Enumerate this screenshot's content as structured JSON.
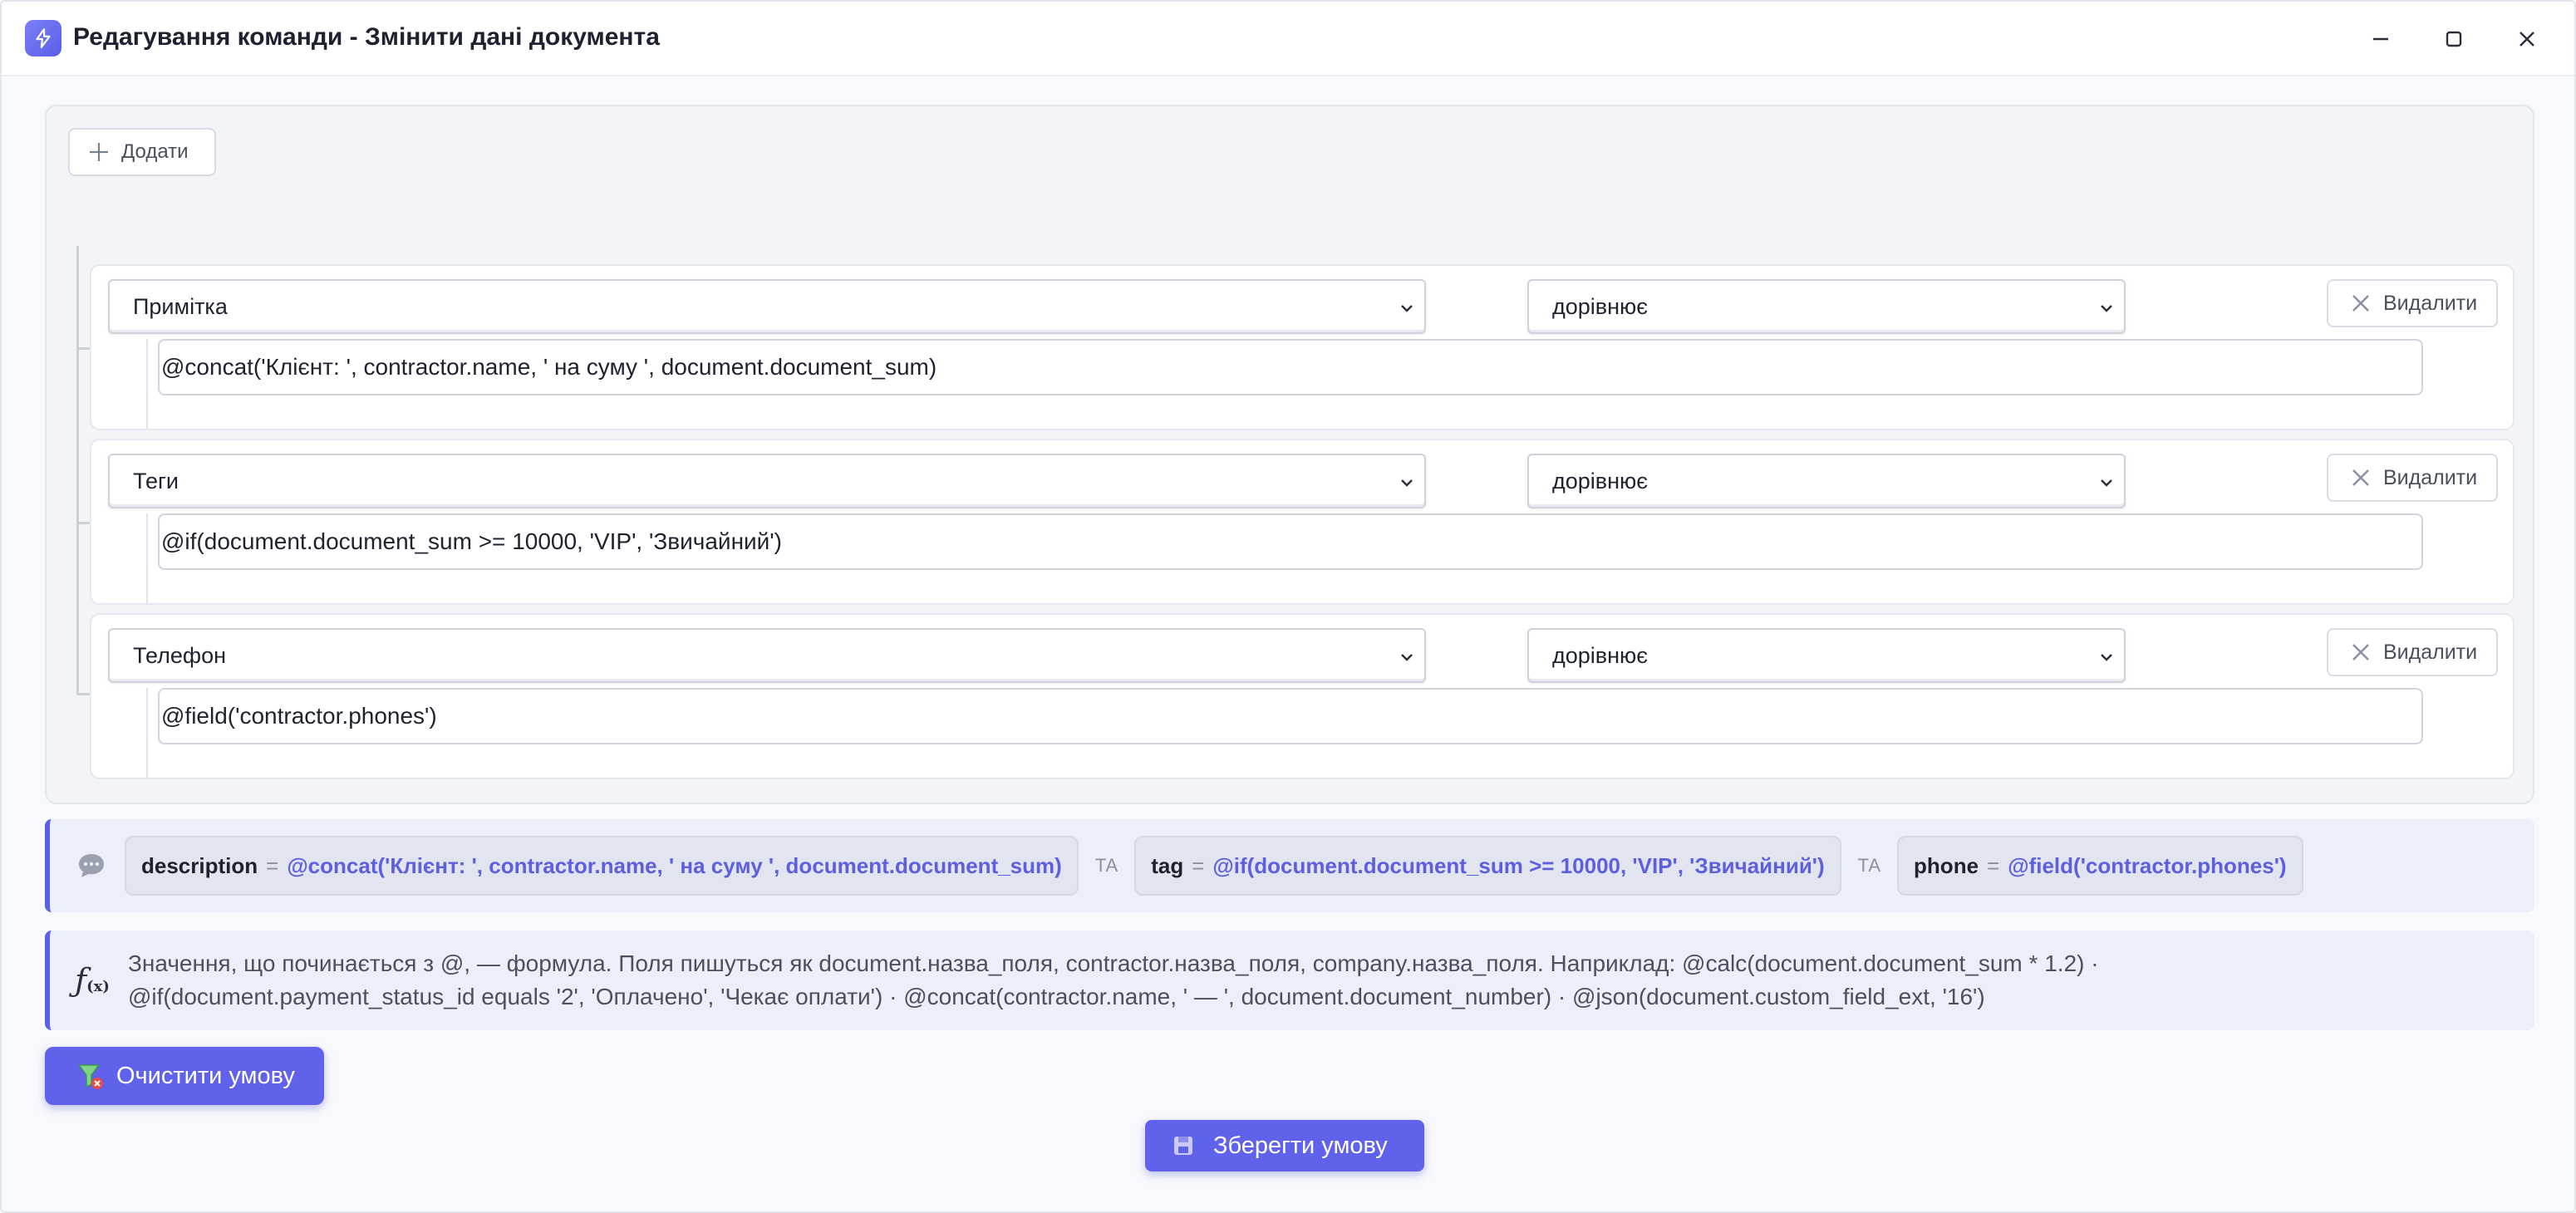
{
  "window": {
    "title": "Редагування команди - Змінити дані документа"
  },
  "toolbar": {
    "add_label": "Додати"
  },
  "rules": [
    {
      "field": "Примітка",
      "operator": "дорівнює",
      "value": "@concat('Клієнт: ', contractor.name, ' на суму ', document.document_sum)",
      "delete_label": "Видалити"
    },
    {
      "field": "Теги",
      "operator": "дорівнює",
      "value": "@if(document.document_sum >= 10000, 'VIP', 'Звичайний')",
      "delete_label": "Видалити"
    },
    {
      "field": "Телефон",
      "operator": "дорівнює",
      "value": "@field('contractor.phones')",
      "delete_label": "Видалити"
    }
  ],
  "summary": {
    "conjunction": "ТА",
    "items": [
      {
        "key": "description",
        "eq": "=",
        "value": "@concat('Клієнт: ', contractor.name, ' на суму ', document.document_sum)"
      },
      {
        "key": "tag",
        "eq": "=",
        "value": "@if(document.document_sum >= 10000, 'VIP', 'Звичайний')"
      },
      {
        "key": "phone",
        "eq": "=",
        "value": "@field('contractor.phones')"
      }
    ]
  },
  "help": {
    "icon_label": "ƒ",
    "icon_sub": "(x)",
    "line1": "Значення, що починається з @, — формула. Поля пишуться як document.назва_поля, contractor.назва_поля, company.назва_поля. Наприклад: @calc(document.document_sum * 1.2) ·",
    "line2": "@if(document.payment_status_id equals '2', 'Оплачено', 'Чекає оплати') · @concat(contractor.name, ' — ', document.document_number) · @json(document.custom_field_ext, '16')"
  },
  "actions": {
    "clear_label": "Очистити умову",
    "save_label": "Зберегти умову"
  },
  "colors": {
    "accent": "#6062ec",
    "value_text": "#5d60de"
  }
}
